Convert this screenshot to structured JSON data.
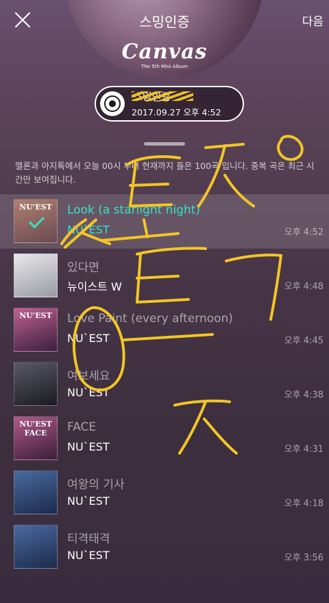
{
  "header": {
    "title": "스밍인증",
    "next_label": "다음",
    "close_icon": "close-icon"
  },
  "album": {
    "logo_text": "Canvas",
    "subtitle": "The 5th Mini Album"
  },
  "badge": {
    "label": "스밍인증",
    "date": "2017.09.27 오후 4:52"
  },
  "info_text": "멜론과 아지톡에서 오늘 00시 부터 현재까지 들은 100곡 입니다. 중복 곡은 최근 시간만 보여집니다.",
  "songs": [
    {
      "title": "Look (a starlight night)",
      "artist": "NU`EST",
      "time": "오후 4:52",
      "thumb_caption": "NU'EST",
      "thumb_colors": [
        "#b08070",
        "#6a4a52"
      ]
    },
    {
      "title": "있다면",
      "artist": "뉴이스트 W",
      "time": "오후 4:48",
      "thumb_caption": "",
      "thumb_colors": [
        "#e8e8ea",
        "#9a9aa4"
      ]
    },
    {
      "title": "Love Paint (every afternoon)",
      "artist": "NU`EST",
      "time": "오후 4:45",
      "thumb_caption": "NU'EST",
      "thumb_colors": [
        "#c06090",
        "#3a2040"
      ]
    },
    {
      "title": "여보세요",
      "artist": "NU`EST",
      "time": "오후 4:38",
      "thumb_caption": "",
      "thumb_colors": [
        "#5a5a66",
        "#1a1a22"
      ]
    },
    {
      "title": "FACE",
      "artist": "NU`EST",
      "time": "오후 4:31",
      "thumb_caption": "NU'EST FACE",
      "thumb_colors": [
        "#b05a8a",
        "#3a1e3a"
      ]
    },
    {
      "title": "여왕의 기사",
      "artist": "NU`EST",
      "time": "오후 4:18",
      "thumb_caption": "",
      "thumb_colors": [
        "#4a6aa0",
        "#1c2a4a"
      ]
    },
    {
      "title": "티격태격",
      "artist": "NU`EST",
      "time": "오후 3:56",
      "thumb_caption": "",
      "thumb_colors": [
        "#4a6aa0",
        "#1c2a4a"
      ]
    }
  ],
  "accent_color": "#35e3c7",
  "scribble_color": "#f3c626"
}
